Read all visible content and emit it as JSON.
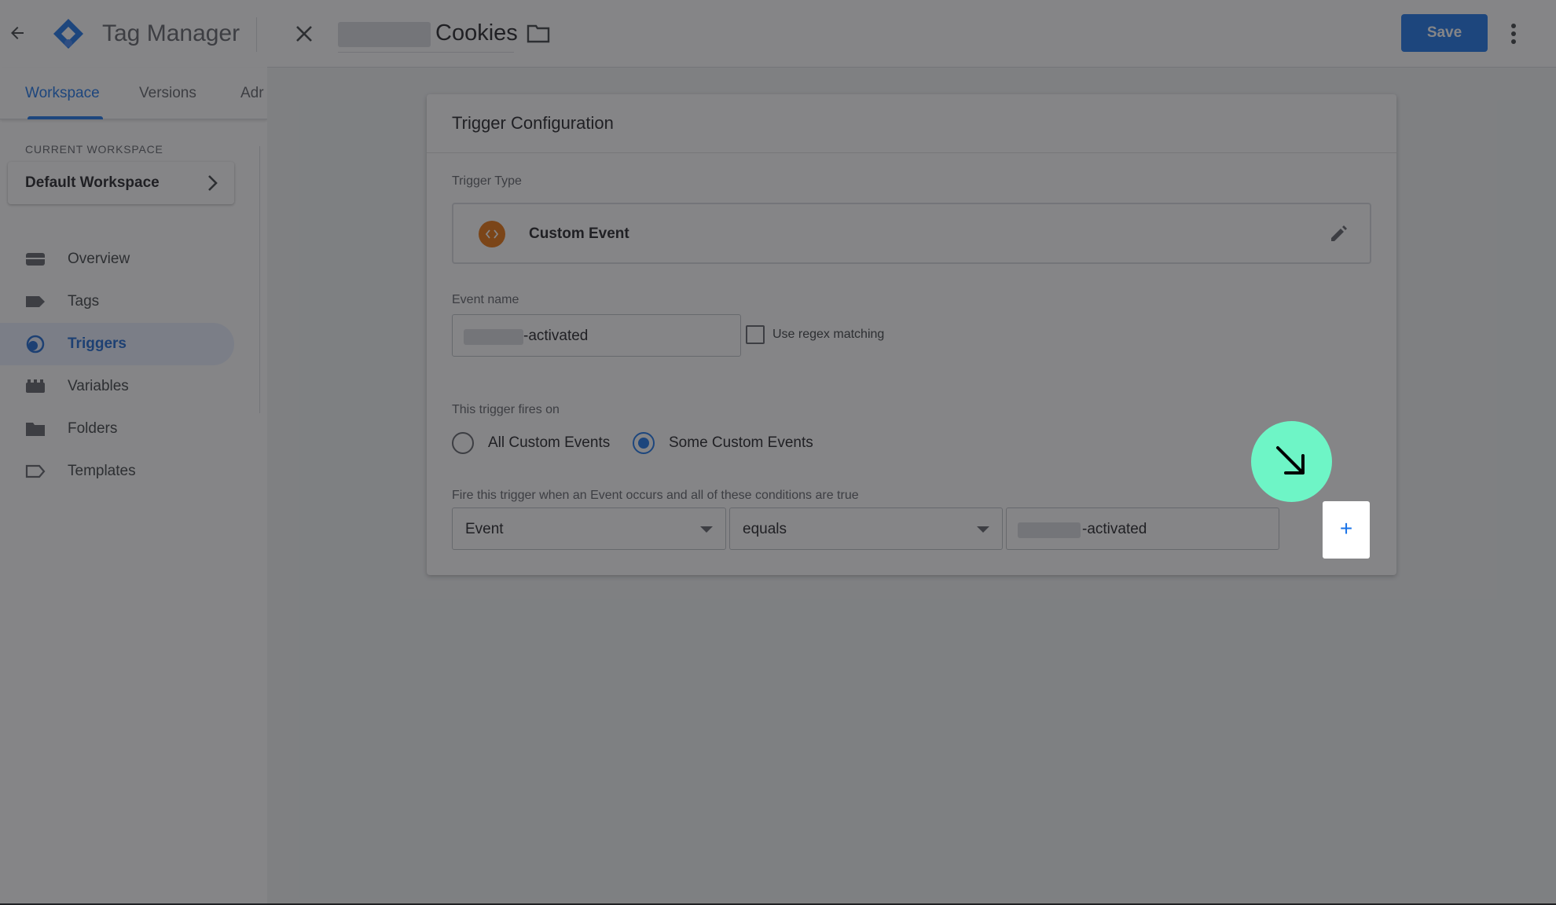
{
  "app": {
    "title": "Tag Manager"
  },
  "tabs": [
    {
      "label": "Workspace"
    },
    {
      "label": "Versions"
    },
    {
      "label": "Adr"
    }
  ],
  "workspace": {
    "section_label": "CURRENT WORKSPACE",
    "name": "Default Workspace"
  },
  "nav": [
    {
      "label": "Overview",
      "icon": "overview-icon"
    },
    {
      "label": "Tags",
      "icon": "tag-icon"
    },
    {
      "label": "Triggers",
      "icon": "trigger-icon"
    },
    {
      "label": "Variables",
      "icon": "variables-icon"
    },
    {
      "label": "Folders",
      "icon": "folder-icon"
    },
    {
      "label": "Templates",
      "icon": "template-icon"
    }
  ],
  "editor": {
    "title": "Cookies",
    "save_label": "Save"
  },
  "trigger_config": {
    "heading": "Trigger Configuration",
    "type_label": "Trigger Type",
    "type_name": "Custom Event",
    "event_name_label": "Event name",
    "event_name_value": "-activated",
    "regex_label": "Use regex matching",
    "fires_on_label": "This trigger fires on",
    "fires_on_options": [
      "All Custom Events",
      "Some Custom Events"
    ],
    "fires_on_selected": "Some Custom Events",
    "conditions_label": "Fire this trigger when an Event occurs and all of these conditions are true",
    "condition": {
      "variable": "Event",
      "operator": "equals",
      "value": "-activated"
    },
    "minus_label": "−",
    "plus_label": "+"
  },
  "colors": {
    "accent": "#1a73e8",
    "custom_event_icon": "#e8710a",
    "cursor_highlight": "#6ef5c6"
  }
}
